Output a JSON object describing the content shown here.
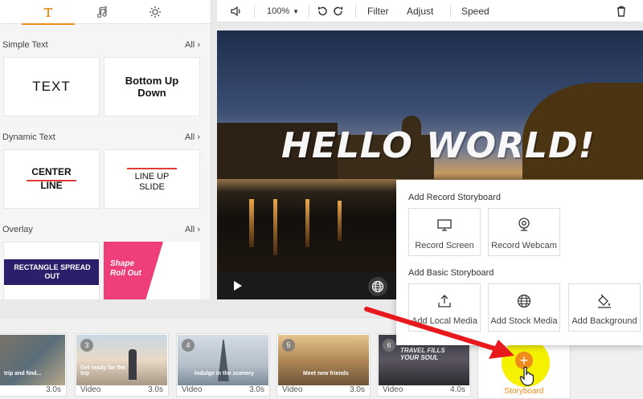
{
  "left_panel": {
    "sections": [
      {
        "title": "Simple Text",
        "all": "All",
        "cards": [
          "TEXT",
          "Bottom Up Down"
        ]
      },
      {
        "title": "Dynamic Text",
        "all": "All",
        "cards": [
          "CENTER LINE",
          "LINE UP SLIDE"
        ]
      },
      {
        "title": "Overlay",
        "all": "All",
        "cards": [
          "RECTANGLE SPREAD OUT",
          "Shape Roll Out"
        ]
      }
    ]
  },
  "toolbar": {
    "zoom": "100%",
    "filter": "Filter",
    "adjust": "Adjust",
    "speed": "Speed"
  },
  "preview": {
    "overlay_text": "HELLO WORLD!"
  },
  "popup": {
    "record_title": "Add Record Storyboard",
    "record_screen": "Record Screen",
    "record_webcam": "Record Webcam",
    "basic_title": "Add Basic Storyboard",
    "local_media": "Add Local Media",
    "stock_media": "Add Stock Media",
    "background": "Add Background"
  },
  "timeline": {
    "clips": [
      {
        "num": "",
        "caption": "trip and find...",
        "type": "",
        "duration": "3.0s"
      },
      {
        "num": "3",
        "caption": "Get ready for the trip",
        "type": "Video",
        "duration": "3.0s"
      },
      {
        "num": "4",
        "caption": "Indulge in the scenery",
        "type": "Video",
        "duration": "3.0s"
      },
      {
        "num": "5",
        "caption": "Meet new friends",
        "type": "Video",
        "duration": "3.0s"
      },
      {
        "num": "6",
        "caption": "TRAVEL FILLS YOUR SOUL",
        "type": "Video",
        "duration": "4.0s"
      }
    ],
    "storyboard_label": "Storyboard"
  },
  "colors": {
    "accent": "#f08c1c",
    "popup_bg": "#ffffff"
  }
}
